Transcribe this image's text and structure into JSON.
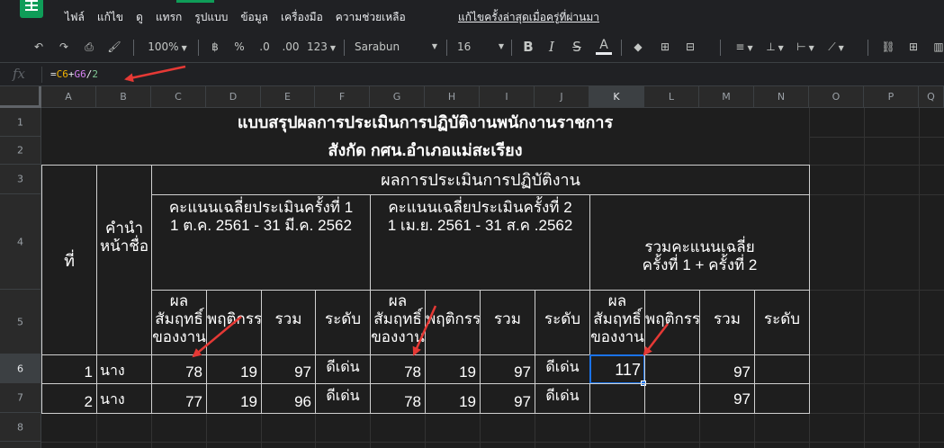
{
  "menu": {
    "items": [
      "ไฟล์",
      "แก้ไข",
      "ดู",
      "แทรก",
      "รูปแบบ",
      "ข้อมูล",
      "เครื่องมือ",
      "ความช่วยเหลือ"
    ],
    "last_edit": "แก้ไขครั้งล่าสุดเมื่อครู่ที่ผ่านมา"
  },
  "toolbar": {
    "zoom": "100%",
    "currency": "฿",
    "percent": "%",
    "dec_decrease": ".0",
    "dec_increase": ".00",
    "more_formats": "123",
    "font": "Sarabun",
    "font_size": "16",
    "bold": "B",
    "italic": "I",
    "strike": "S",
    "text_color": "A"
  },
  "formula_bar": {
    "fx": "fx",
    "eq": "=",
    "ref1": "C6",
    "op1": "+",
    "ref2": "G6",
    "op2": "/",
    "num": "2"
  },
  "columns": [
    "A",
    "B",
    "C",
    "D",
    "E",
    "F",
    "G",
    "H",
    "I",
    "J",
    "K",
    "L",
    "M",
    "N",
    "O",
    "P",
    "Q"
  ],
  "rows": [
    "1",
    "2",
    "3",
    "4",
    "5",
    "6",
    "7",
    "8"
  ],
  "sheet": {
    "title1": "แบบสรุปผลการประเมินการปฏิบัติงานพนักงานราชการ",
    "title2": "สังกัด กศน.อำเภอแม่สะเรียง",
    "h_no": "ที่",
    "h_name": "คำนำหน้าชื่อ",
    "h_result": "ผลการประเมินการปฏิบัติงาน",
    "h_round1": "คะแนนเฉลี่ยประเมินครั้งที่ 1\n1 ต.ค. 2561 - 31 มี.ค. 2562",
    "h_round2": "คะแนนเฉลี่ยประเมินครั้งที่ 2\n1 เม.ย. 2561 - 31 ส.ค .2562",
    "h_total": "รวมคะแนนเฉลี่ย\nครั้งที่ 1 + ครั้งที่ 2",
    "h_achieve1": "ผลสัมฤทธิ์ของงาน",
    "h_behavior1": "พฤติกรรม",
    "h_sum1": "รวม",
    "h_level1": "ระดับ",
    "h_achieve2": "ผลสัมฤทธิ์ของงาน",
    "h_behavior2": "พฤติกรรม",
    "h_sum2": "รวม",
    "h_level2": "ระดับ",
    "h_achieve3": "ผลสัมฤทธิ์ของงาน",
    "h_behavior3": "พฤติกรรม",
    "h_sum3": "รวม",
    "h_level3": "ระดับ",
    "r6": {
      "no": "1",
      "prefix": "นาง",
      "c": "78",
      "d": "19",
      "e": "97",
      "f": "ดีเด่น",
      "g": "78",
      "h": "19",
      "i": "97",
      "j": "ดีเด่น",
      "k": "117",
      "m": "97"
    },
    "r7": {
      "no": "2",
      "prefix": "นาง",
      "c": "77",
      "d": "19",
      "e": "96",
      "f": "ดีเด่น",
      "g": "78",
      "h": "19",
      "i": "97",
      "j": "ดีเด่น",
      "m": "97"
    }
  },
  "colors": {
    "selection": "#1a73e8",
    "arrow": "#e53935",
    "ref1": "#f4b400",
    "ref2": "#d682f4"
  }
}
